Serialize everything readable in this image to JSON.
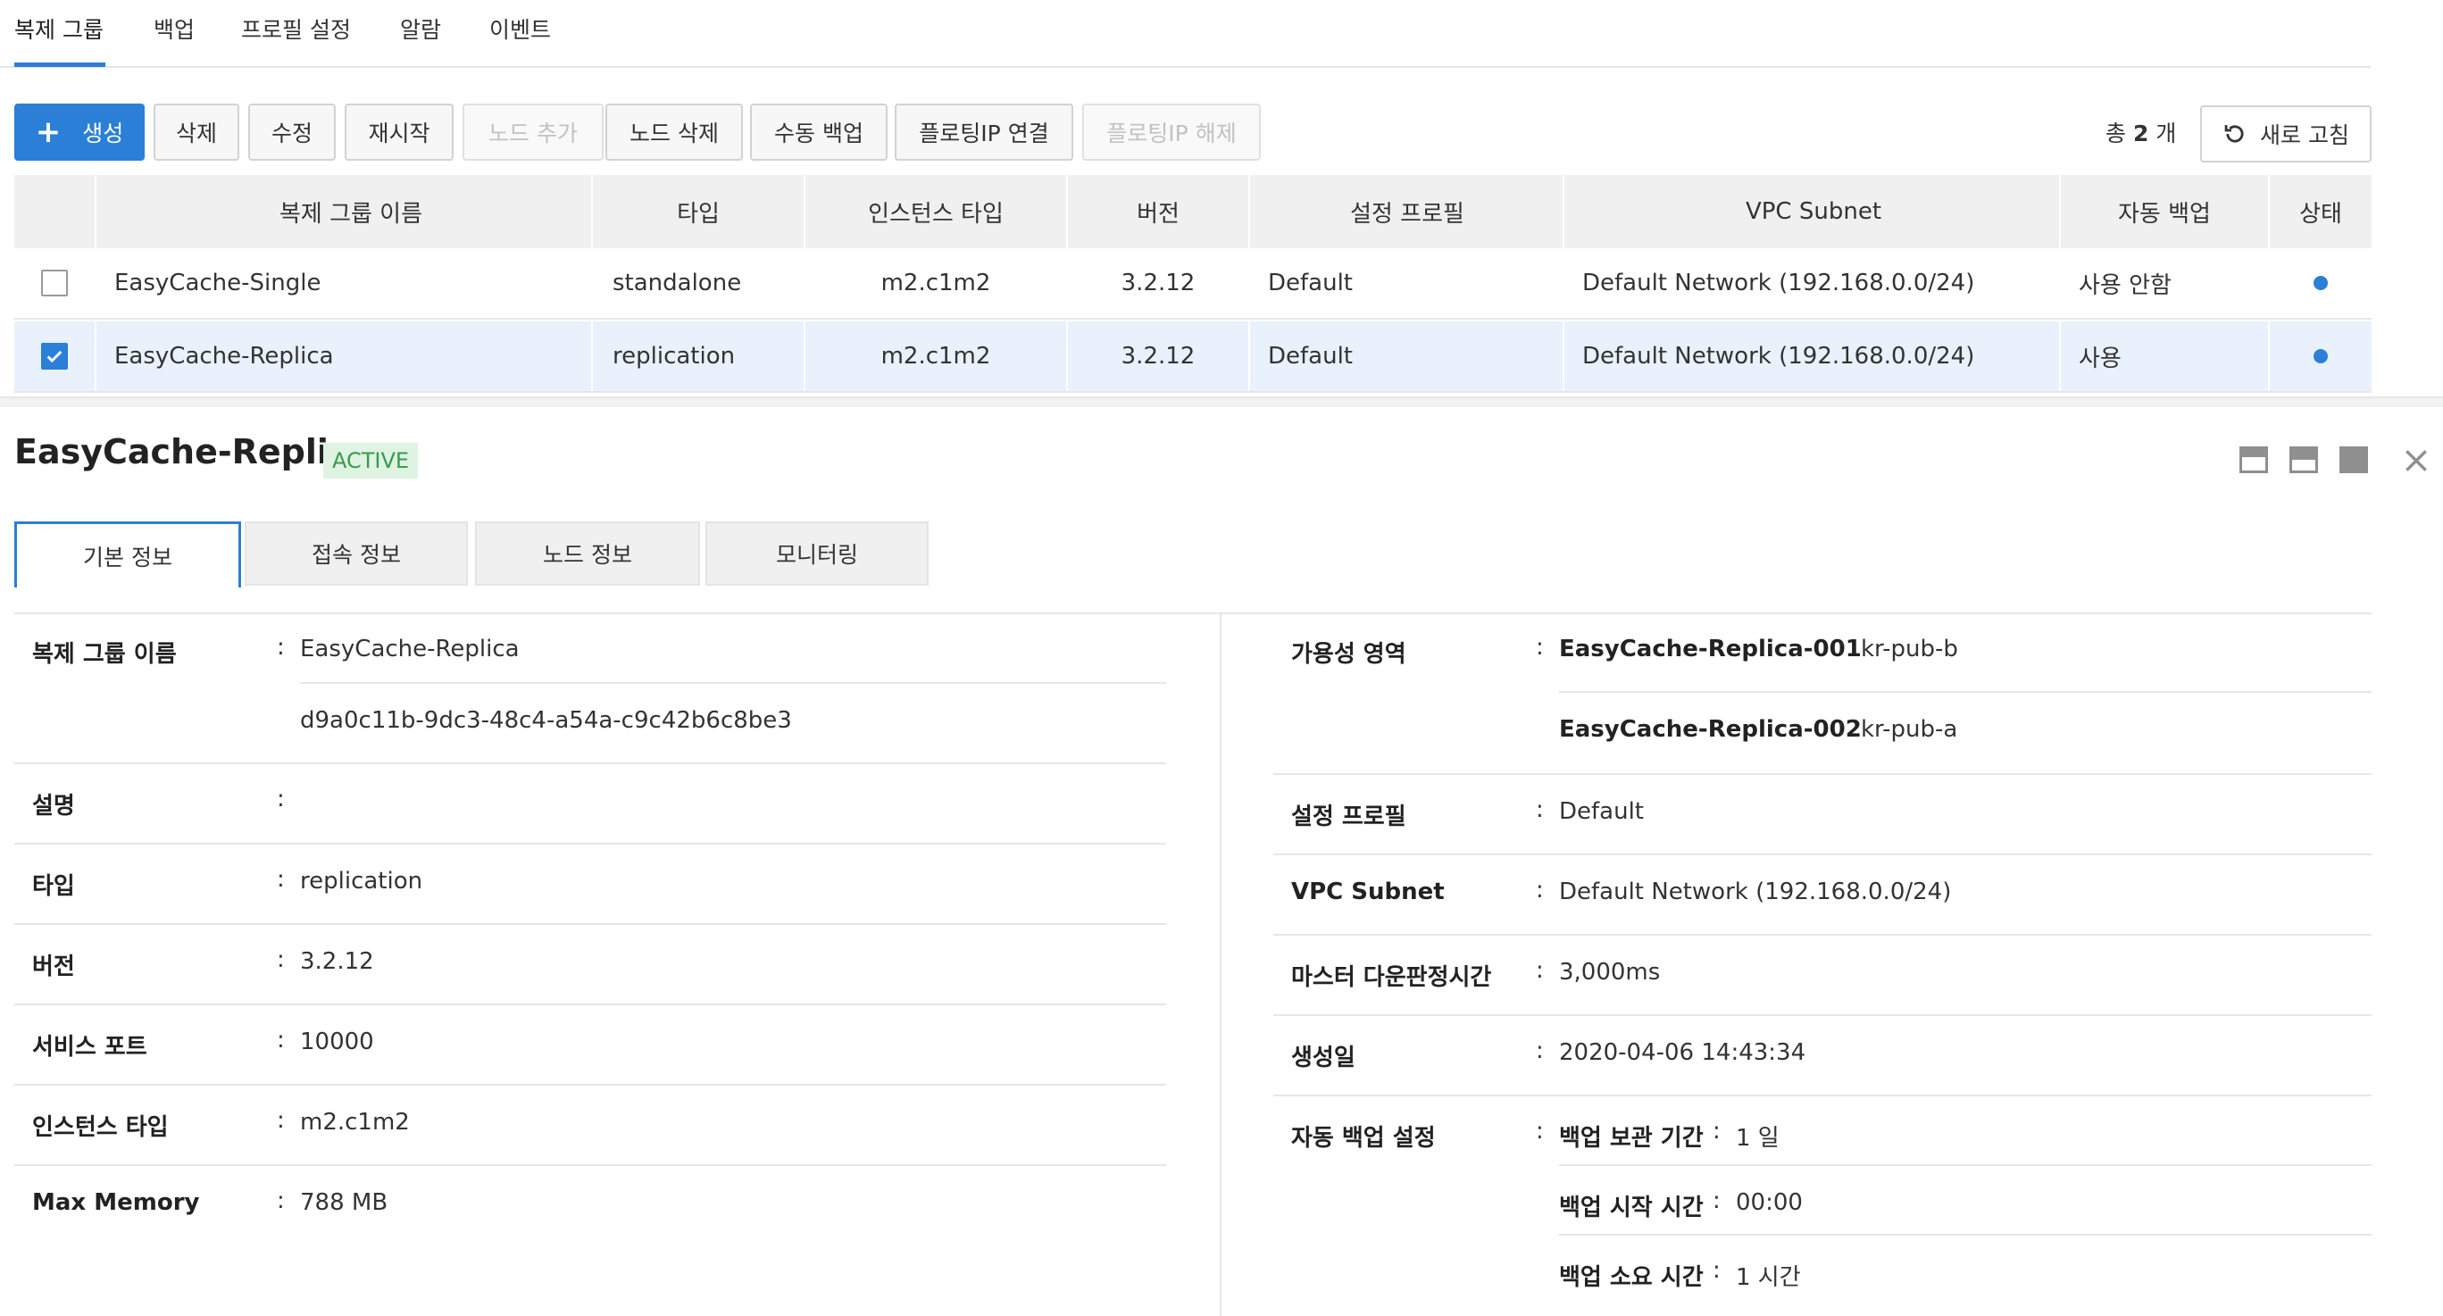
{
  "top_tabs": [
    "복제 그룹",
    "백업",
    "프로필 설정",
    "알람",
    "이벤트"
  ],
  "toolbar": {
    "create": "생성",
    "delete": "삭제",
    "edit": "수정",
    "restart": "재시작",
    "add_node": "노드 추가",
    "delete_node": "노드 삭제",
    "manual_backup": "수동 백업",
    "attach_fip": "플로팅IP 연결",
    "detach_fip": "플로팅IP 해제",
    "total_prefix": "총",
    "total_count": "2",
    "total_suffix": "개",
    "refresh": "새로 고침"
  },
  "table": {
    "headers": [
      "복제 그룹 이름",
      "타입",
      "인스턴스 타입",
      "버전",
      "설정 프로필",
      "VPC Subnet",
      "자동 백업",
      "상태"
    ],
    "rows": [
      {
        "checked": false,
        "name": "EasyCache-Single",
        "type": "standalone",
        "instance_type": "m2.c1m2",
        "version": "3.2.12",
        "profile": "Default",
        "subnet": "Default Network (192.168.0.0/24)",
        "auto_backup": "사용 안함"
      },
      {
        "checked": true,
        "name": "EasyCache-Replica",
        "type": "replication",
        "instance_type": "m2.c1m2",
        "version": "3.2.12",
        "profile": "Default",
        "subnet": "Default Network (192.168.0.0/24)",
        "auto_backup": "사용"
      }
    ],
    "status_color": "#2b7fd6"
  },
  "detail": {
    "title": "EasyCache-Replica",
    "status": "ACTIVE",
    "tabs": [
      "기본 정보",
      "접속 정보",
      "노드 정보",
      "모니터링"
    ],
    "left": {
      "group_name_label": "복제 그룹 이름",
      "group_name": "EasyCache-Replica",
      "group_id": "d9a0c11b-9dc3-48c4-a54a-c9c42b6c8be3",
      "desc_label": "설명",
      "desc": "",
      "type_label": "타입",
      "type": "replication",
      "version_label": "버전",
      "version": "3.2.12",
      "port_label": "서비스 포트",
      "port": "10000",
      "instance_type_label": "인스턴스 타입",
      "instance_type": "m2.c1m2",
      "max_memory_label": "Max Memory",
      "max_memory": "788 MB"
    },
    "right": {
      "az_label": "가용성 영역",
      "az": [
        {
          "node": "EasyCache-Replica-001",
          "zone": "kr-pub-b"
        },
        {
          "node": "EasyCache-Replica-002",
          "zone": "kr-pub-a"
        }
      ],
      "profile_label": "설정 프로필",
      "profile": "Default",
      "subnet_label": "VPC Subnet",
      "subnet": "Default Network (192.168.0.0/24)",
      "master_label": "마스터 다운판정시간",
      "master": "3,000ms",
      "created_label": "생성일",
      "created": "2020-04-06 14:43:34",
      "backup_label": "자동 백업 설정",
      "backup": [
        {
          "label": "백업 보관 기간",
          "value": "1 일"
        },
        {
          "label": "백업 시작 시간",
          "value": "00:00"
        },
        {
          "label": "백업 소요 시간",
          "value": "1 시간"
        }
      ]
    }
  },
  "colors": {
    "accent": "#2b7fd6",
    "active_badge_bg": "#dff3e3",
    "active_badge_text": "#3a9a4d"
  }
}
